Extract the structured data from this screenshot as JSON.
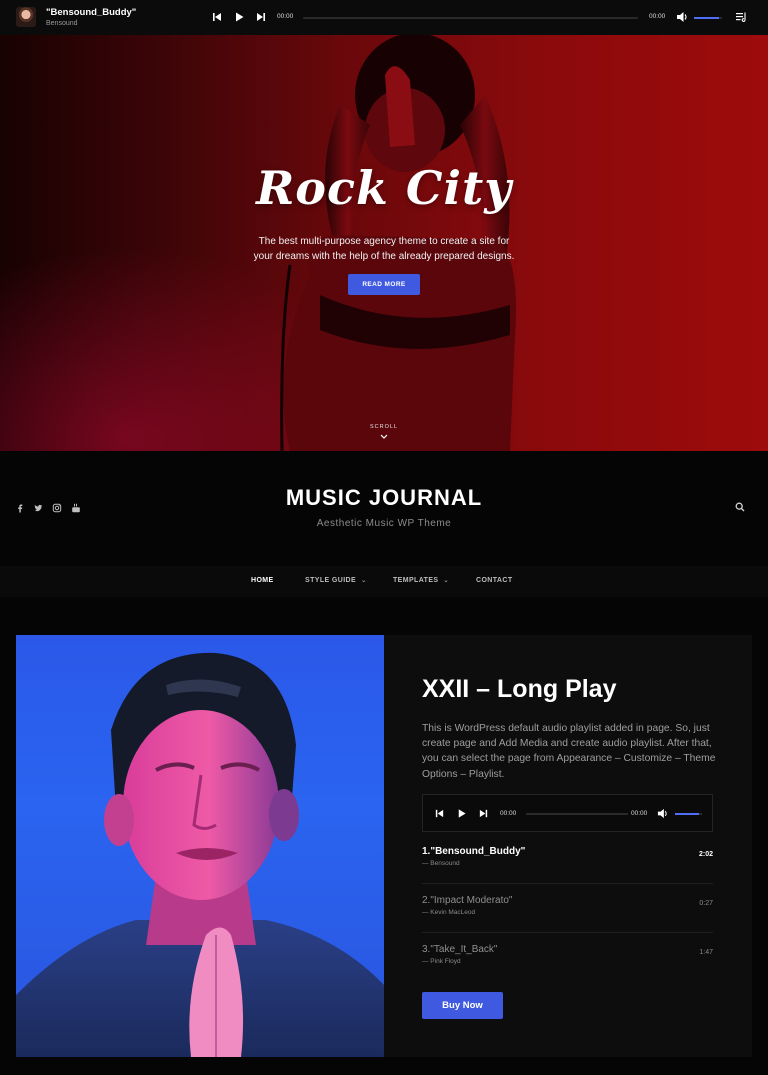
{
  "player": {
    "track_title": "\"Bensound_Buddy\"",
    "artist": "Bensound",
    "current_time": "00:00",
    "total_time": "00:00",
    "volume_fraction": 0.9,
    "icons": [
      "skip-back-icon",
      "play-icon",
      "skip-forward-icon",
      "volume-icon",
      "playlist-icon"
    ]
  },
  "hero": {
    "title": "Rock City",
    "subtitle_line1": "The best multi-purpose agency theme to create a site for",
    "subtitle_line2": "your dreams with the help of the already prepared designs.",
    "button_label": "READ MORE",
    "scroll_label": "SCROLL"
  },
  "site": {
    "title": "MUSIC JOURNAL",
    "tagline": "Aesthetic Music WP Theme",
    "social_icons": [
      "facebook-icon",
      "twitter-icon",
      "instagram-icon",
      "youtube-icon"
    ]
  },
  "nav": {
    "items": [
      {
        "label": "HOME",
        "active": true
      },
      {
        "label": "STYLE GUIDE",
        "has_dropdown": true
      },
      {
        "label": "TEMPLATES",
        "has_dropdown": true
      },
      {
        "label": "CONTACT"
      }
    ]
  },
  "album": {
    "title": "XXII – Long Play",
    "description": "This is WordPress default audio playlist added in page. So, just create page and Add Media and create audio playlist. After that, you can select the page from Appearance – Customize – Theme Options – Playlist.",
    "player": {
      "current_time": "00:00",
      "total_time": "00:00",
      "volume_fraction": 0.9
    },
    "tracks": [
      {
        "number": "1.",
        "name": "\"Bensound_Buddy\"",
        "artist": "— Bensound",
        "duration": "2:02",
        "active": true
      },
      {
        "number": "2.",
        "name": "\"Impact Moderato\"",
        "artist": "— Kevin MacLeod",
        "duration": "0:27"
      },
      {
        "number": "3.",
        "name": "\"Take_It_Back\"",
        "artist": "— Pink Floyd",
        "duration": "1:47"
      }
    ],
    "buy_label": "Buy Now"
  },
  "colors": {
    "accent": "#3f5ae0",
    "hero_red": "#8a0a0c",
    "background": "#050505"
  }
}
